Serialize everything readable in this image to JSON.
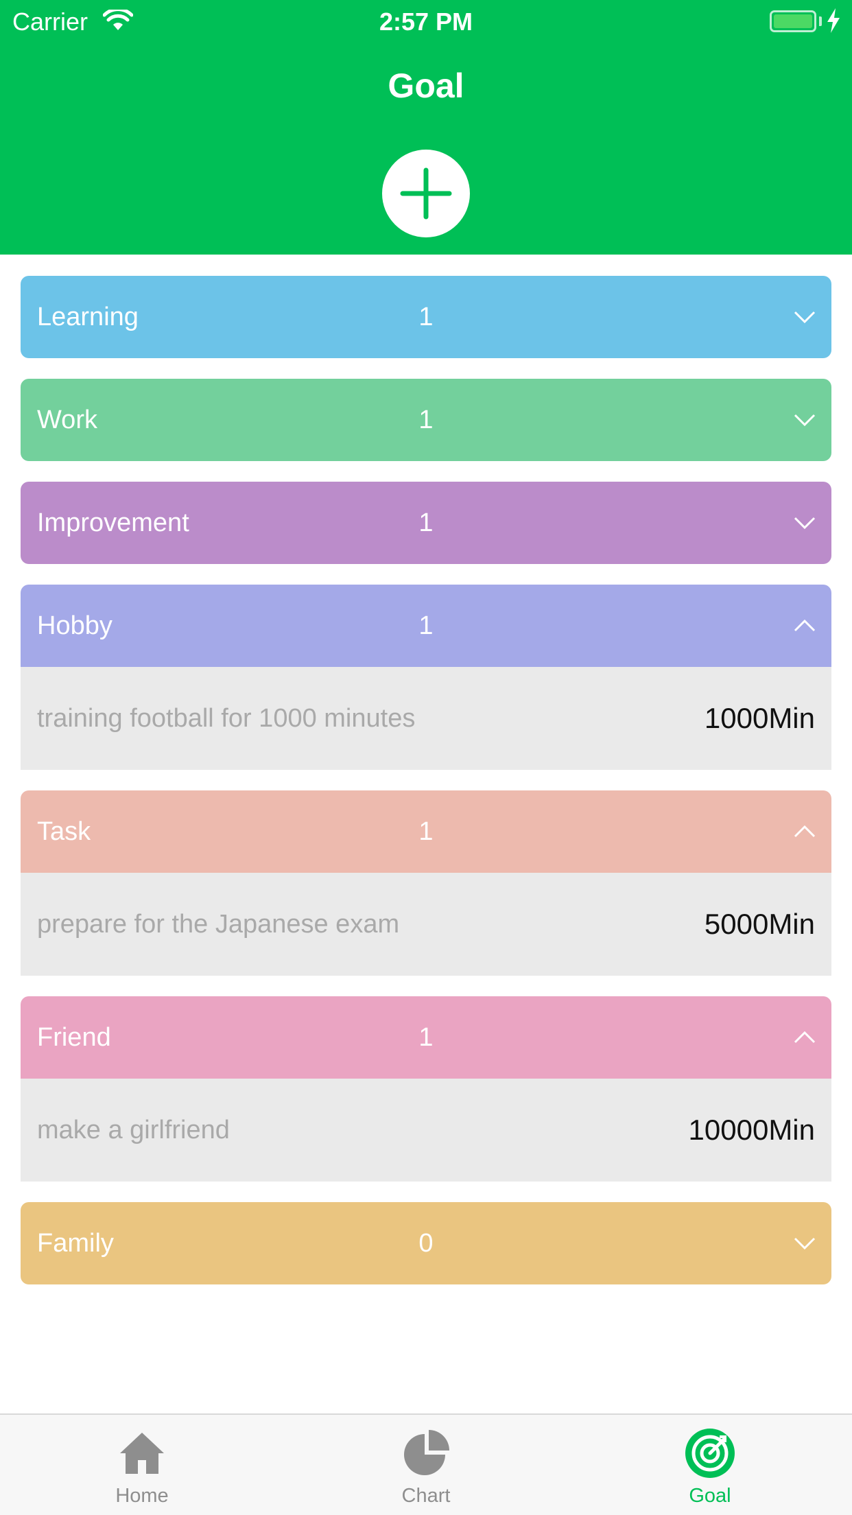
{
  "status_bar": {
    "carrier": "Carrier",
    "time": "2:57 PM"
  },
  "header": {
    "title": "Goal",
    "add_icon": "plus-circle-icon"
  },
  "colors": {
    "brand": "#00BF56",
    "learning": "#6CC3E8",
    "work": "#73D09C",
    "improvement": "#BB8CCA",
    "hobby": "#A4A9E8",
    "task": "#EDBAAE",
    "friend": "#EAA4C2",
    "family": "#EAC580"
  },
  "categories": [
    {
      "name": "Learning",
      "count": "1",
      "expanded": false
    },
    {
      "name": "Work",
      "count": "1",
      "expanded": false
    },
    {
      "name": "Improvement",
      "count": "1",
      "expanded": false
    },
    {
      "name": "Hobby",
      "count": "1",
      "expanded": true,
      "goal": {
        "description": "training football for 1000 minutes",
        "minutes": "1000Min"
      }
    },
    {
      "name": "Task",
      "count": "1",
      "expanded": true,
      "goal": {
        "description": "prepare for the Japanese exam",
        "minutes": "5000Min"
      }
    },
    {
      "name": "Friend",
      "count": "1",
      "expanded": true,
      "goal": {
        "description": "make a girlfriend",
        "minutes": "10000Min"
      }
    },
    {
      "name": "Family",
      "count": "0",
      "expanded": false
    }
  ],
  "tabbar": {
    "tabs": [
      {
        "label": "Home",
        "icon": "home-icon",
        "active": false
      },
      {
        "label": "Chart",
        "icon": "pie-chart-icon",
        "active": false
      },
      {
        "label": "Goal",
        "icon": "target-icon",
        "active": true
      }
    ]
  }
}
